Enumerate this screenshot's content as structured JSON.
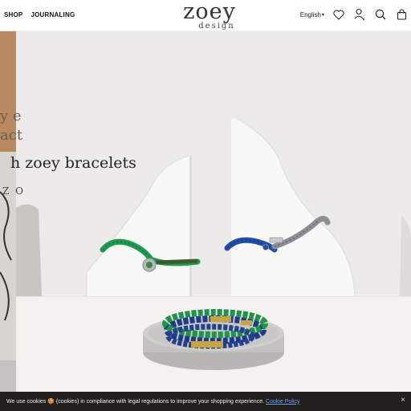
{
  "header": {
    "nav": [
      {
        "label": "SHOP"
      },
      {
        "label": "JOURNALING"
      }
    ],
    "logo": {
      "main": "zoey",
      "sub": "design"
    },
    "language": "English",
    "icons": [
      "heart-icon",
      "user-icon",
      "search-icon",
      "bag-icon"
    ]
  },
  "hero": {
    "partial_line_1": "y e",
    "partial_line_2": "act",
    "title": "h zoey bracelets",
    "partial_logo": "Z O"
  },
  "cookie": {
    "text": "We use cookies 🍪 (cookies) in compliance with legal regulations to improve your shopping experience.",
    "link": "Cookie Policy",
    "close": "×"
  },
  "colors": {
    "accent_link": "#6ea0e8",
    "cookie_bg": "#231f1d",
    "bracelet_green": "#1e9a52",
    "bracelet_blue": "#1f4fa8",
    "bracelet_grey": "#8d8f96"
  }
}
